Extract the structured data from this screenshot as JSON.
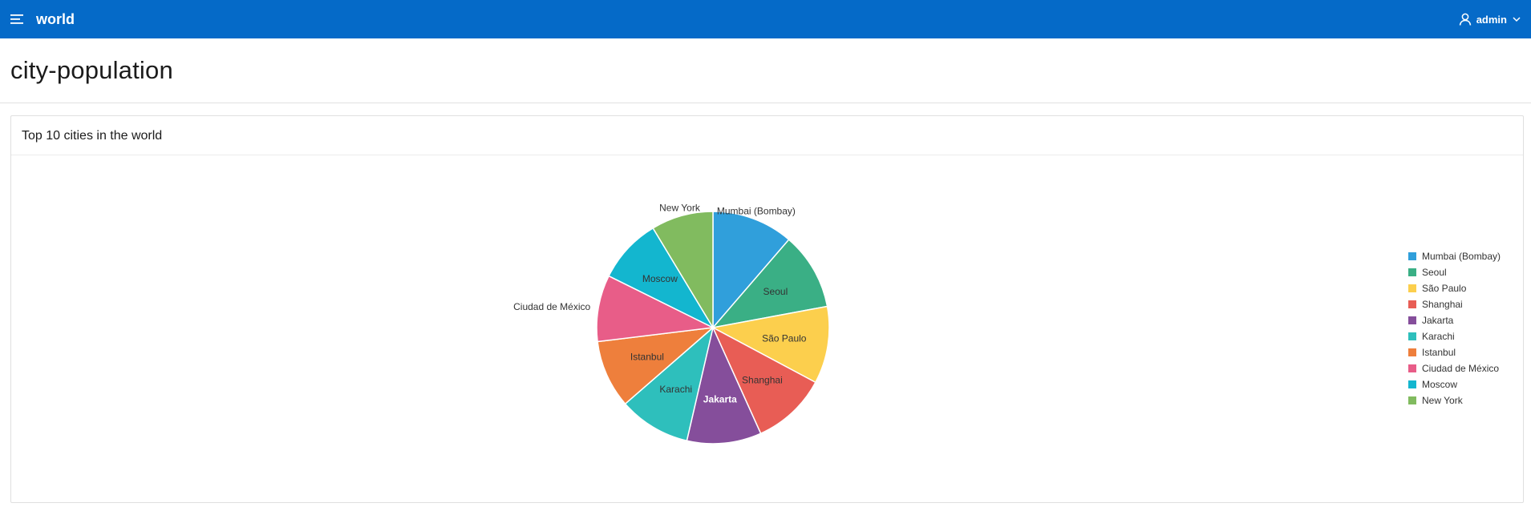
{
  "app": {
    "title": "world",
    "user": "admin"
  },
  "page": {
    "title": "city-population"
  },
  "region": {
    "title": "Top 10 cities in the world"
  },
  "icons": {
    "menu": "hamburger-menu-icon",
    "user": "user-icon",
    "dropdown": "chevron-down-icon"
  },
  "colors": {
    "header": "#056ac8",
    "header_text": "#ffffff"
  },
  "chart_data": {
    "type": "pie",
    "title": "",
    "legend_position": "right",
    "slices": [
      {
        "label": "Mumbai (Bombay)",
        "value": 10500000,
        "color": "#309fdb",
        "label_inside": false
      },
      {
        "label": "Seoul",
        "value": 9981619,
        "color": "#3aaf85",
        "label_inside": true
      },
      {
        "label": "São Paulo",
        "value": 9968485,
        "color": "#fccf4d",
        "label_inside": true
      },
      {
        "label": "Shanghai",
        "value": 9696300,
        "color": "#e85d55",
        "label_inside": true
      },
      {
        "label": "Jakarta",
        "value": 9604900,
        "color": "#854e9b",
        "label_inside": true
      },
      {
        "label": "Karachi",
        "value": 9269265,
        "color": "#2ebfbc",
        "label_inside": true
      },
      {
        "label": "Istanbul",
        "value": 8787958,
        "color": "#ee7f3c",
        "label_inside": true
      },
      {
        "label": "Ciudad de México",
        "value": 8591309,
        "color": "#e85d88",
        "label_inside": false
      },
      {
        "label": "Moscow",
        "value": 8389200,
        "color": "#13b6cf",
        "label_inside": true
      },
      {
        "label": "New York",
        "value": 8008278,
        "color": "#81bb5f",
        "label_inside": false
      }
    ]
  }
}
